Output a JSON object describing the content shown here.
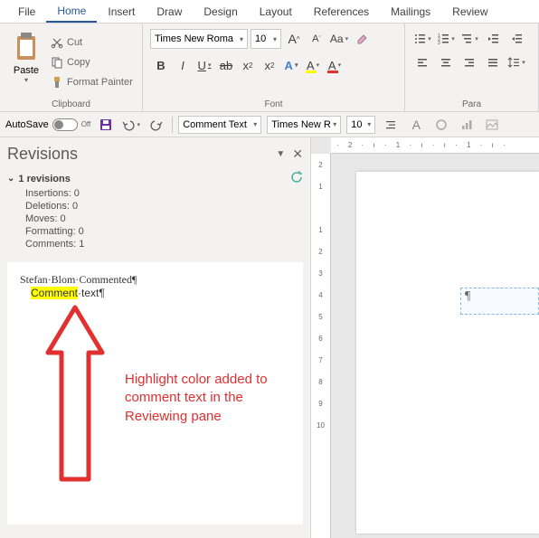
{
  "menu": {
    "items": [
      "File",
      "Home",
      "Insert",
      "Draw",
      "Design",
      "Layout",
      "References",
      "Mailings",
      "Review"
    ],
    "active": "Home"
  },
  "ribbon": {
    "clipboard": {
      "label": "Clipboard",
      "paste": "Paste",
      "cut": "Cut",
      "copy": "Copy",
      "format_painter": "Format Painter"
    },
    "font": {
      "label": "Font",
      "name": "Times New Roma",
      "size": "10",
      "grow": "A",
      "shrink": "A",
      "case": "Aa",
      "bold": "B",
      "italic": "I",
      "underline": "U",
      "strike": "ab",
      "sub": "x",
      "sup": "x",
      "effects": "A",
      "highlight": "A",
      "color": "A"
    },
    "paragraph": {
      "label": "Para"
    }
  },
  "qat": {
    "autosave": "AutoSave",
    "off": "Off",
    "style": "Comment Text",
    "font": "Times New R",
    "size": "10"
  },
  "revisions": {
    "title": "Revisions",
    "count_label": "1 revisions",
    "insertions": "Insertions: 0",
    "deletions": "Deletions: 0",
    "moves": "Moves: 0",
    "formatting": "Formatting: 0",
    "comments": "Comments: 1",
    "card": {
      "author_line": "Stefan·Blom·Commented¶",
      "highlighted": "Comment",
      "rest": "·text¶"
    }
  },
  "annotation": {
    "text": "Highlight color added to comment text in the Reviewing pane"
  },
  "ruler": {
    "h": "· 2 · ı · 1 · ı ·     ı · 1 · ı ·",
    "v": [
      "2",
      "1",
      "",
      "1",
      "2",
      "3",
      "4",
      "5",
      "6",
      "7",
      "8",
      "9",
      "10"
    ]
  }
}
